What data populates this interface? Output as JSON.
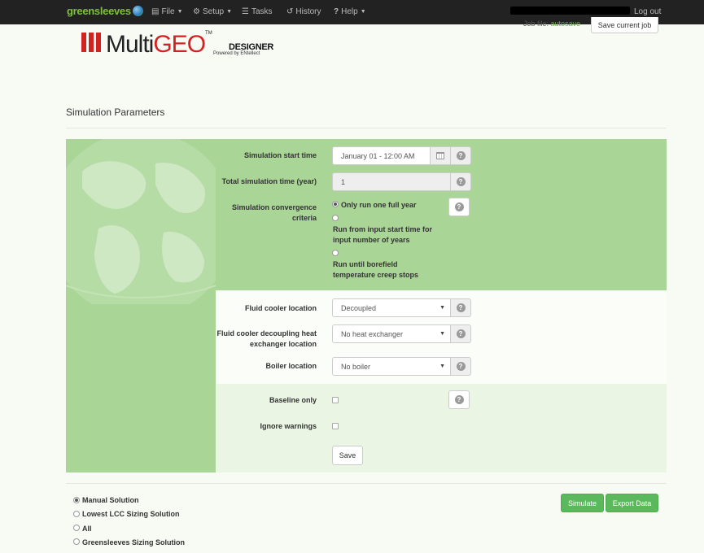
{
  "nav": {
    "brand": "greensleeves",
    "menu": [
      {
        "label": "File",
        "icon": "file-icon"
      },
      {
        "label": "Setup",
        "icon": "gear-icon"
      },
      {
        "label": "Tasks",
        "icon": "list-icon"
      },
      {
        "label": "History",
        "icon": "history-icon"
      },
      {
        "label": "Help",
        "icon": "question-icon"
      }
    ],
    "logout": "Log out"
  },
  "header": {
    "logo_multi": "Multi",
    "logo_geo": "GEO",
    "logo_tm": "TM",
    "logo_designer": "DESIGNER",
    "logo_powered": "Powered by ENtellect",
    "job_file_label": "Job file:",
    "job_file_value": "autosave",
    "save_job_button": "Save current job"
  },
  "page": {
    "title": "Simulation Parameters"
  },
  "form": {
    "start_time": {
      "label": "Simulation start time",
      "value": "January 01 - 12:00 AM"
    },
    "total_time": {
      "label": "Total simulation time (year)",
      "value": "1"
    },
    "convergence": {
      "label_line1": "Simulation convergence",
      "label_line2": "criteria",
      "options": [
        {
          "line1": "Only run one full year",
          "line2": "",
          "selected": true
        },
        {
          "line1": "Run from input start time for",
          "line2": "input number of years",
          "selected": false
        },
        {
          "line1": "Run until borefield",
          "line2": "temperature creep stops",
          "selected": false
        }
      ]
    },
    "fluid_cooler_location": {
      "label": "Fluid cooler location",
      "value": "Decoupled"
    },
    "fluid_cooler_hx": {
      "label_line1": "Fluid cooler decoupling heat",
      "label_line2": "exchanger location",
      "value": "No heat exchanger"
    },
    "boiler_location": {
      "label": "Boiler location",
      "value": "No boiler"
    },
    "baseline_only": {
      "label": "Baseline only",
      "checked": false
    },
    "ignore_warnings": {
      "label": "Ignore warnings",
      "checked": false
    },
    "save_button": "Save"
  },
  "solutions": [
    {
      "label": "Manual Solution",
      "selected": true
    },
    {
      "label": "Lowest LCC Sizing Solution",
      "selected": false
    },
    {
      "label": "All",
      "selected": false
    },
    {
      "label": "Greensleeves Sizing Solution",
      "selected": false
    }
  ],
  "actions": {
    "simulate": "Simulate",
    "export": "Export Data"
  },
  "colors": {
    "accent_green": "#5cb85c",
    "panel_green": "#a9d596",
    "logo_red": "#d32222",
    "navbar": "#222222"
  }
}
